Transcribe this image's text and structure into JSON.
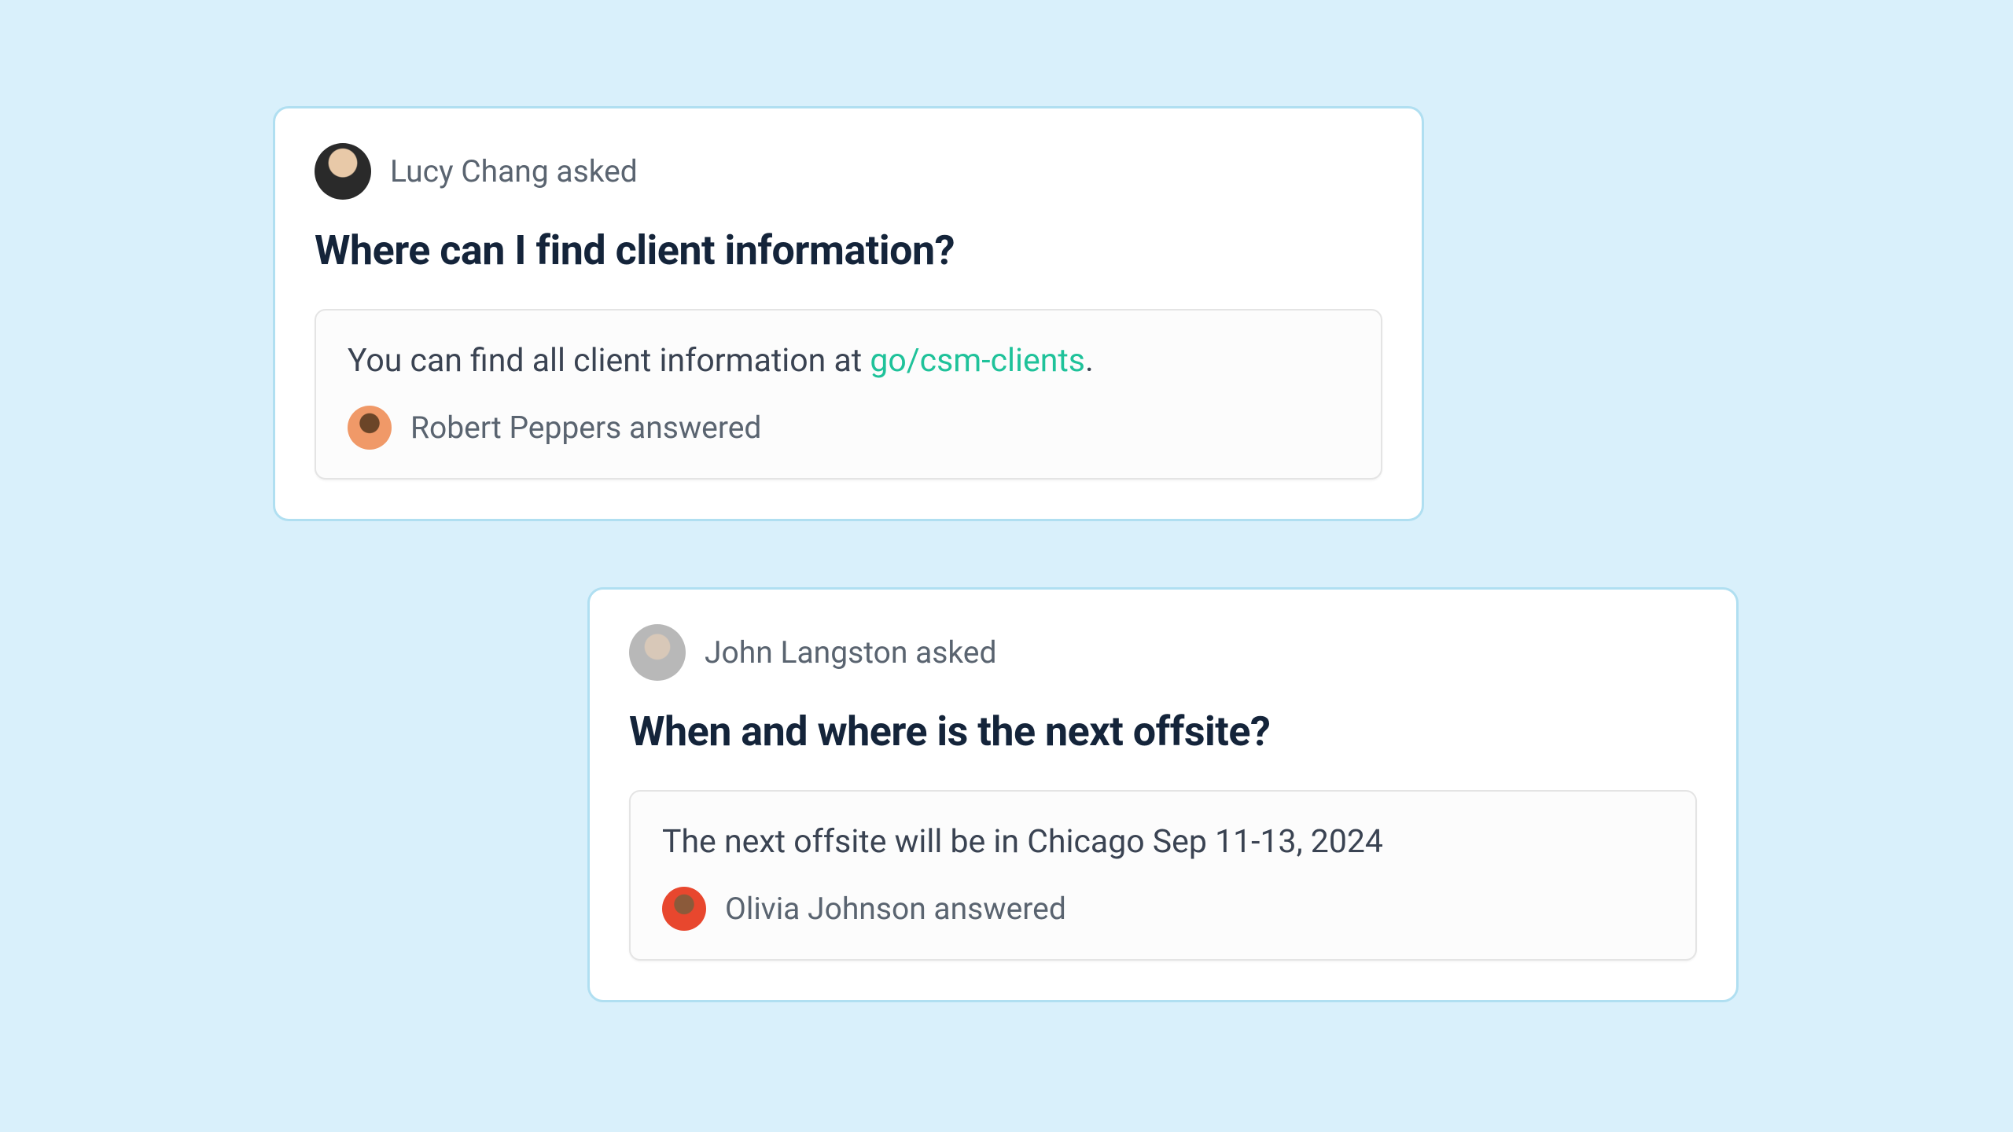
{
  "cards": [
    {
      "asker_label": "Lucy Chang asked",
      "question": "Where can I find client information?",
      "answer_prefix": "You can find all client information at ",
      "answer_link": "go/csm-clients",
      "answer_suffix": ".",
      "answerer_label": "Robert Peppers answered"
    },
    {
      "asker_label": "John Langston asked",
      "question": "When and where is the next offsite?",
      "answer_text": "The next offsite will be in Chicago Sep 11-13, 2024",
      "answerer_label": "Olivia Johnson answered"
    }
  ]
}
